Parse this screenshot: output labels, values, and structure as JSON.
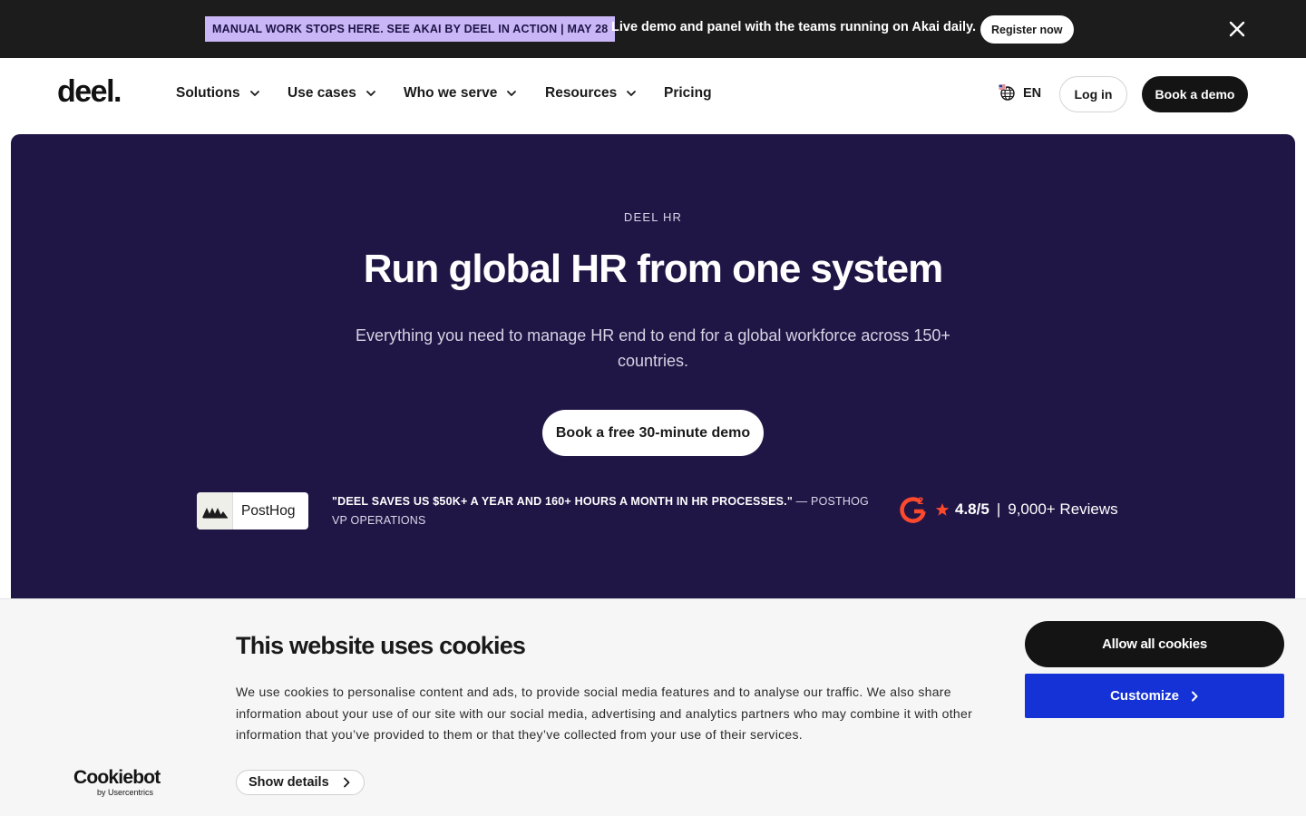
{
  "announcement": {
    "tag": "MANUAL WORK STOPS HERE. SEE AKAI BY DEEL IN ACTION | MAY 28",
    "message": "Live demo and panel with the teams running on Akai daily.",
    "register_label": "Register now"
  },
  "header": {
    "logo": "deel.",
    "nav": [
      {
        "label": "Solutions"
      },
      {
        "label": "Use cases"
      },
      {
        "label": "Who we serve"
      },
      {
        "label": "Resources"
      },
      {
        "label": "Pricing"
      }
    ],
    "lang": "EN",
    "login_label": "Log in",
    "book_demo_label": "Book a demo"
  },
  "hero": {
    "eyebrow": "DEEL HR",
    "headline": "Run global HR from one system",
    "subtext": "Everything you need to manage HR end to end for a global workforce across 150+ countries.",
    "cta_label": "Book a free 30-minute demo",
    "customer_name": "PostHog",
    "quote_text": "\"DEEL SAVES US $50K+ A YEAR AND 160+ HOURS A MONTH IN HR PROCESSES.\"",
    "quote_attribution": " — POSTHOG VP OPERATIONS",
    "g2_rating": "4.8/5",
    "g2_separator": "|",
    "g2_reviews": "9,000+ Reviews",
    "g2_rating_value": 4.8,
    "g2_rating_max": 5
  },
  "cookie_banner": {
    "title": "This website uses cookies",
    "body": "We use cookies to personalise content and ads, to provide social media features and to analyse our traffic. We also share information about your use of our site with our social media, advertising and analytics partners who may combine it with other information that you’ve provided to them or that they’ve collected from your use of their services.",
    "show_details_label": "Show details",
    "allow_all_label": "Allow all cookies",
    "customize_label": "Customize",
    "brand": "Cookiebot",
    "brand_sub": "by Usercentrics"
  },
  "colors": {
    "hero_bg": "#201646",
    "announcement_bg": "#1c1c1c",
    "tag_bg": "#c9b6f7",
    "customize_bg": "#1532d6",
    "g2_red": "#ff492c"
  },
  "icons": [
    "close-icon",
    "chevron-down-icon",
    "globe-flag-icon",
    "posthog-logo-icon",
    "g2-logo-icon",
    "star-icon",
    "chevron-right-icon"
  ]
}
